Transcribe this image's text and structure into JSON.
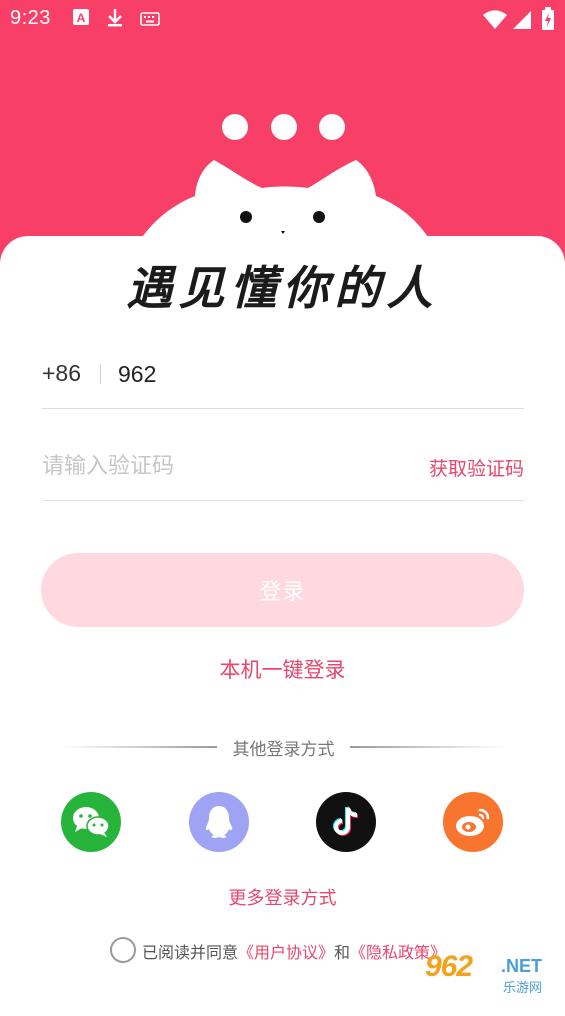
{
  "status_bar": {
    "time": "9:23",
    "left_icons": [
      "font-a-icon",
      "download-icon",
      "keyboard-icon"
    ],
    "right_icons": [
      "wifi-icon",
      "signal-icon",
      "battery-charging-icon"
    ]
  },
  "header": {
    "slogan": "遇见懂你的人",
    "brand_color": "#f73f67"
  },
  "login_form": {
    "country_code": "+86",
    "phone_value": "962",
    "code_placeholder": "请输入验证码",
    "get_code_label": "获取验证码",
    "login_button_label": "登录",
    "one_key_login_label": "本机一键登录"
  },
  "other_login": {
    "label": "其他登录方式",
    "providers": [
      {
        "name": "wechat-icon",
        "color": "#27b43b"
      },
      {
        "name": "qq-icon",
        "color": "#9fa3f4"
      },
      {
        "name": "douyin-icon",
        "color": "#111111"
      },
      {
        "name": "weibo-icon",
        "color": "#f7752e"
      }
    ],
    "more_label": "更多登录方式"
  },
  "agreement": {
    "prefix": "已阅读并同意",
    "user_agreement": "《用户协议》",
    "and": "和",
    "privacy_policy": "《隐私政策》"
  },
  "watermark": {
    "main": "962",
    "net": ".NET",
    "sub": "乐游网"
  }
}
